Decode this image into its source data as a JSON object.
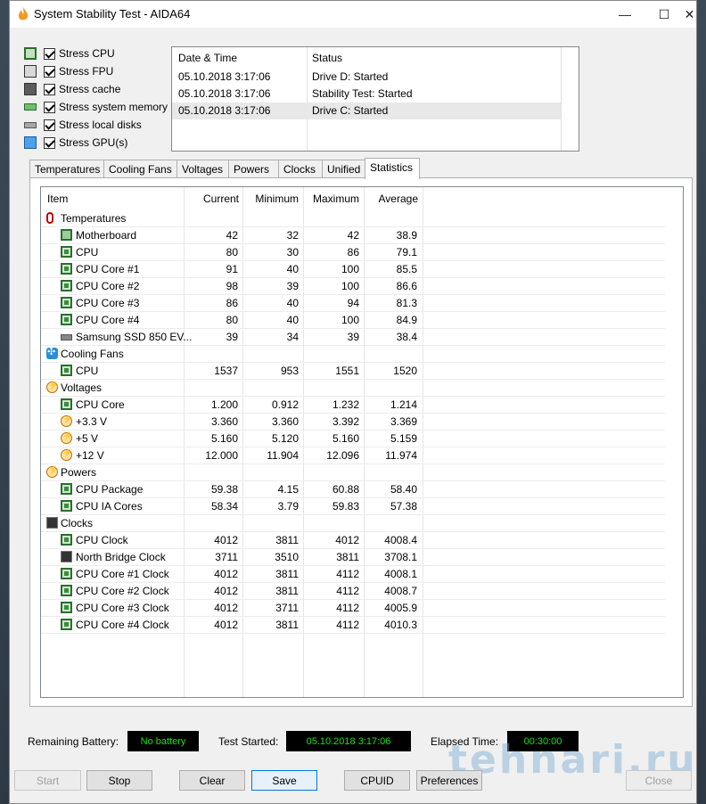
{
  "window": {
    "title": "System Stability Test - AIDA64",
    "controls": {
      "minimize": "—",
      "maximize": "☐",
      "close": "✕"
    }
  },
  "stress_options": [
    {
      "label": "Stress CPU",
      "icon": "cpu-icon",
      "checked": true
    },
    {
      "label": "Stress FPU",
      "icon": "fpu-icon",
      "checked": true
    },
    {
      "label": "Stress cache",
      "icon": "cache-icon",
      "checked": true
    },
    {
      "label": "Stress system memory",
      "icon": "memory-icon",
      "checked": true
    },
    {
      "label": "Stress local disks",
      "icon": "disk-icon",
      "checked": true
    },
    {
      "label": "Stress GPU(s)",
      "icon": "gpu-icon",
      "checked": true
    }
  ],
  "log": {
    "headers": {
      "datetime": "Date & Time",
      "status": "Status"
    },
    "rows": [
      {
        "datetime": "05.10.2018 3:17:06",
        "status": "Drive D: Started"
      },
      {
        "datetime": "05.10.2018 3:17:06",
        "status": "Stability Test: Started"
      },
      {
        "datetime": "05.10.2018 3:17:06",
        "status": "Drive C: Started"
      }
    ]
  },
  "tabs": [
    "Temperatures",
    "Cooling Fans",
    "Voltages",
    "Powers",
    "Clocks",
    "Unified",
    "Statistics"
  ],
  "active_tab": "Statistics",
  "stats": {
    "headers": {
      "item": "Item",
      "current": "Current",
      "minimum": "Minimum",
      "maximum": "Maximum",
      "average": "Average"
    },
    "rows": [
      {
        "group": true,
        "icon": "thermometer-icon",
        "item": "Temperatures"
      },
      {
        "icon": "motherboard-icon",
        "item": "Motherboard",
        "current": "42",
        "minimum": "32",
        "maximum": "42",
        "average": "38.9"
      },
      {
        "icon": "chip-icon",
        "item": "CPU",
        "current": "80",
        "minimum": "30",
        "maximum": "86",
        "average": "79.1"
      },
      {
        "icon": "chip-icon",
        "item": "CPU Core #1",
        "current": "91",
        "minimum": "40",
        "maximum": "100",
        "average": "85.5"
      },
      {
        "icon": "chip-icon",
        "item": "CPU Core #2",
        "current": "98",
        "minimum": "39",
        "maximum": "100",
        "average": "86.6"
      },
      {
        "icon": "chip-icon",
        "item": "CPU Core #3",
        "current": "86",
        "minimum": "40",
        "maximum": "94",
        "average": "81.3"
      },
      {
        "icon": "chip-icon",
        "item": "CPU Core #4",
        "current": "80",
        "minimum": "40",
        "maximum": "100",
        "average": "84.9"
      },
      {
        "icon": "disk-icon",
        "item": "Samsung SSD 850 EV...",
        "current": "39",
        "minimum": "34",
        "maximum": "39",
        "average": "38.4"
      },
      {
        "group": true,
        "icon": "fan-icon",
        "item": "Cooling Fans"
      },
      {
        "icon": "chip-icon",
        "item": "CPU",
        "current": "1537",
        "minimum": "953",
        "maximum": "1551",
        "average": "1520"
      },
      {
        "group": true,
        "icon": "voltage-icon",
        "item": "Voltages"
      },
      {
        "icon": "chip-icon",
        "item": "CPU Core",
        "current": "1.200",
        "minimum": "0.912",
        "maximum": "1.232",
        "average": "1.214"
      },
      {
        "icon": "voltage-icon",
        "item": "+3.3 V",
        "current": "3.360",
        "minimum": "3.360",
        "maximum": "3.392",
        "average": "3.369"
      },
      {
        "icon": "voltage-icon",
        "item": "+5 V",
        "current": "5.160",
        "minimum": "5.120",
        "maximum": "5.160",
        "average": "5.159"
      },
      {
        "icon": "voltage-icon",
        "item": "+12 V",
        "current": "12.000",
        "minimum": "11.904",
        "maximum": "12.096",
        "average": "11.974"
      },
      {
        "group": true,
        "icon": "power-icon",
        "item": "Powers"
      },
      {
        "icon": "chip-icon",
        "item": "CPU Package",
        "current": "59.38",
        "minimum": "4.15",
        "maximum": "60.88",
        "average": "58.40"
      },
      {
        "icon": "chip-icon",
        "item": "CPU IA Cores",
        "current": "58.34",
        "minimum": "3.79",
        "maximum": "59.83",
        "average": "57.38"
      },
      {
        "group": true,
        "icon": "clock-icon",
        "item": "Clocks"
      },
      {
        "icon": "chip-icon",
        "item": "CPU Clock",
        "current": "4012",
        "minimum": "3811",
        "maximum": "4012",
        "average": "4008.4"
      },
      {
        "icon": "northbridge-icon",
        "item": "North Bridge Clock",
        "current": "3711",
        "minimum": "3510",
        "maximum": "3811",
        "average": "3708.1"
      },
      {
        "icon": "chip-icon",
        "item": "CPU Core #1 Clock",
        "current": "4012",
        "minimum": "3811",
        "maximum": "4112",
        "average": "4008.1"
      },
      {
        "icon": "chip-icon",
        "item": "CPU Core #2 Clock",
        "current": "4012",
        "minimum": "3811",
        "maximum": "4112",
        "average": "4008.7"
      },
      {
        "icon": "chip-icon",
        "item": "CPU Core #3 Clock",
        "current": "4012",
        "minimum": "3711",
        "maximum": "4112",
        "average": "4005.9"
      },
      {
        "icon": "chip-icon",
        "item": "CPU Core #4 Clock",
        "current": "4012",
        "minimum": "3811",
        "maximum": "4112",
        "average": "4010.3"
      }
    ]
  },
  "status_bar": {
    "battery_label": "Remaining Battery:",
    "battery_value": "No battery",
    "started_label": "Test Started:",
    "started_value": "05.10.2018 3:17:06",
    "elapsed_label": "Elapsed Time:",
    "elapsed_value": "00:30:00"
  },
  "buttons": {
    "start": "Start",
    "stop": "Stop",
    "clear": "Clear",
    "save": "Save",
    "cpuid": "CPUID",
    "preferences": "Preferences",
    "close": "Close"
  },
  "watermark": "tehnari.ru",
  "colors": {
    "counter_text": "#18e018",
    "counter_bg": "#000000"
  }
}
